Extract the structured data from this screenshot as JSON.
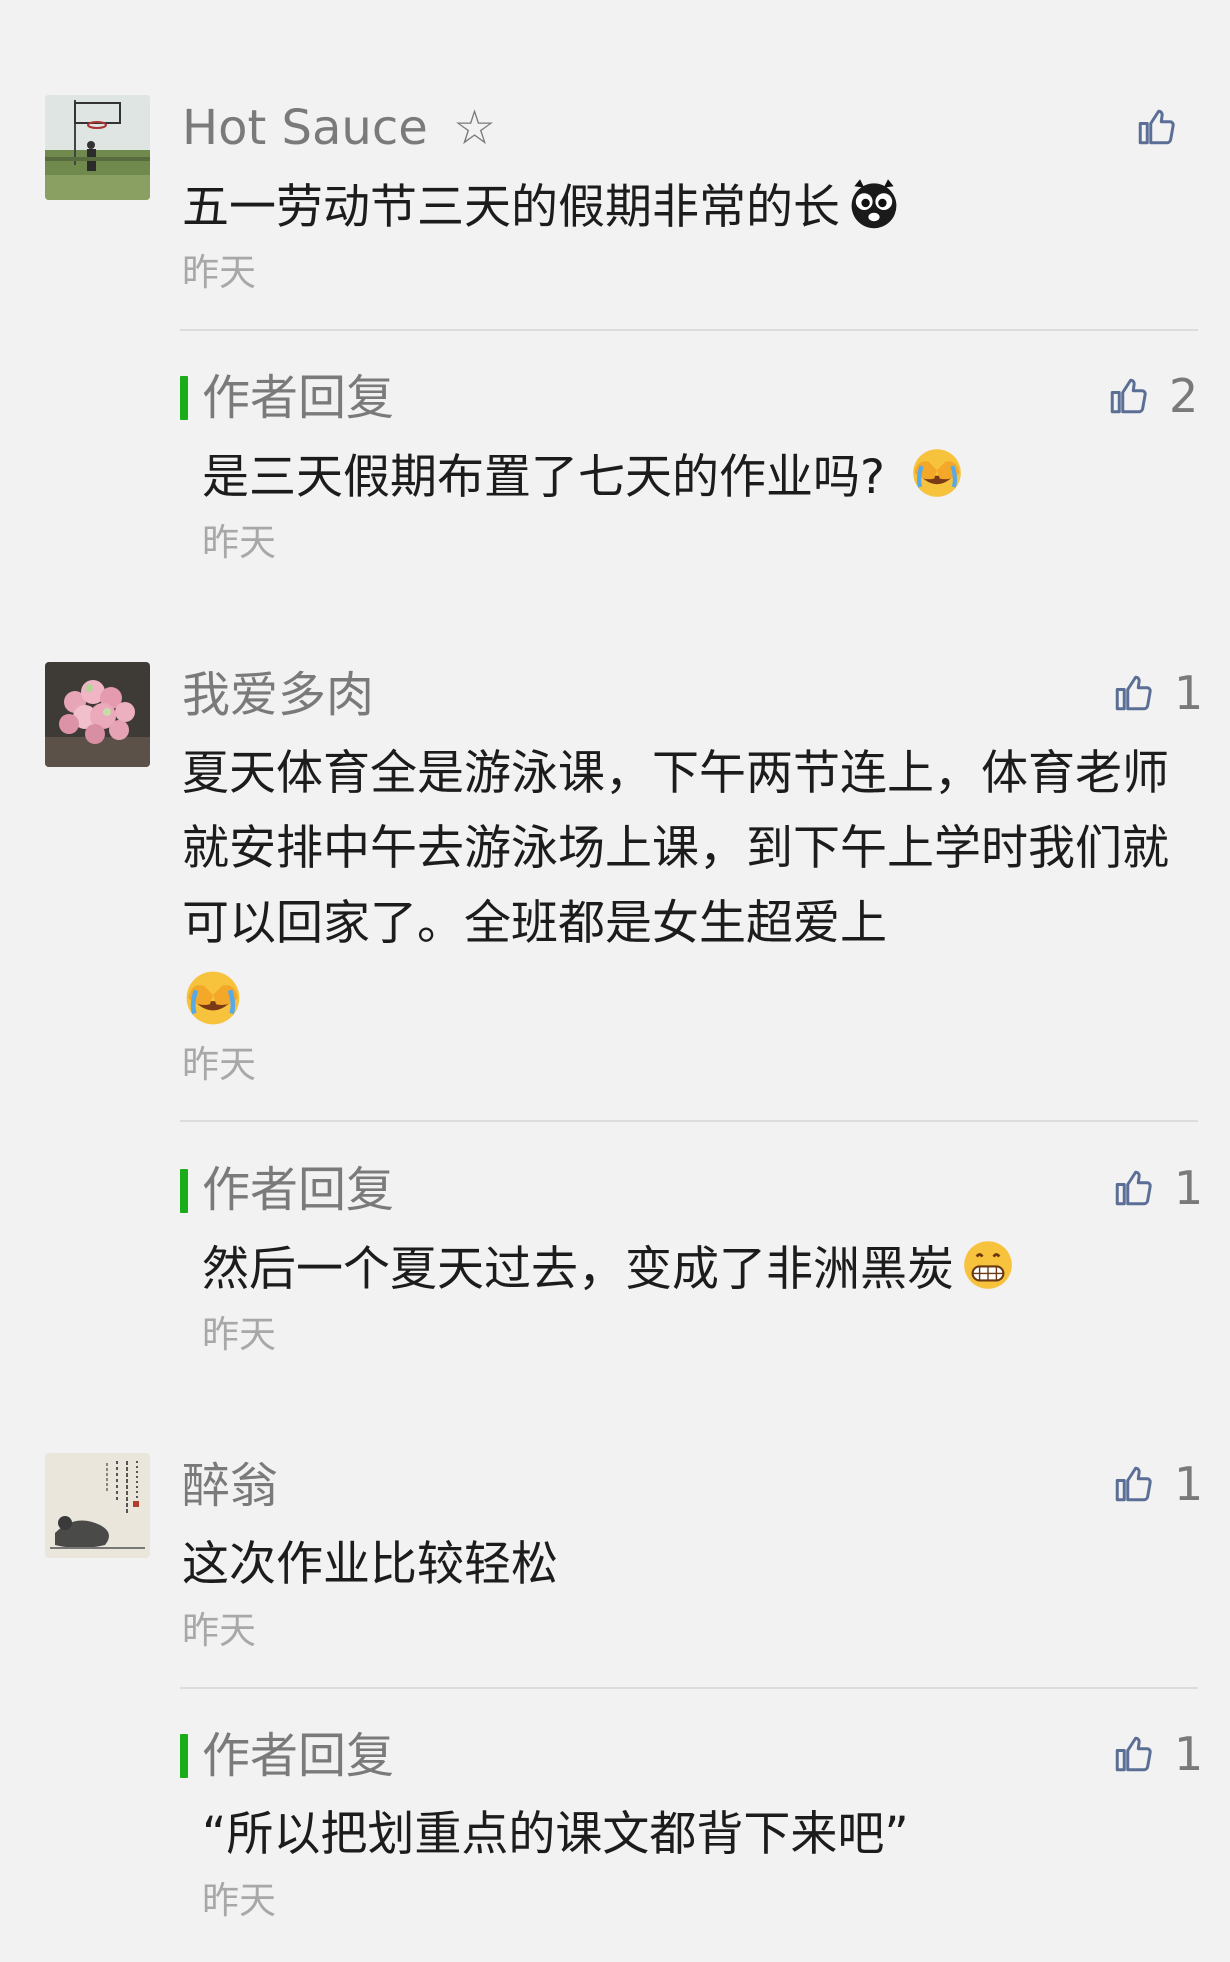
{
  "reply_label": "作者回复",
  "comments": [
    {
      "name": "Hot Sauce",
      "star": "☆",
      "text": "五一劳动节三天的假期非常的长",
      "time": "昨天",
      "likes": "",
      "avatar": "basketball-photo",
      "emoji": "scared-face-icon",
      "reply": {
        "text": "是三天假期布置了七天的作业吗?",
        "time": "昨天",
        "likes": "2",
        "emoji": "face-palm-icon"
      }
    },
    {
      "name": "我爱多肉",
      "text": "夏天体育全是游泳课，下午两节连上，体育老师就安排中午去游泳场上课，到下午上学时我们就可以回家了。全班都是女生超爱上",
      "time": "昨天",
      "likes": "1",
      "avatar": "succulent-photo",
      "emoji": "face-palm-icon",
      "reply": {
        "text": "然后一个夏天过去，变成了非洲黑炭",
        "time": "昨天",
        "likes": "1",
        "emoji": "grimace-face-icon"
      }
    },
    {
      "name": "醉翁",
      "text": "这次作业比较轻松",
      "time": "昨天",
      "likes": "1",
      "avatar": "ink-painting-photo",
      "reply": {
        "text": "“所以把划重点的课文都背下来吧”",
        "time": "昨天",
        "likes": "1"
      }
    }
  ],
  "colors": {
    "background": "#f2f2f2",
    "reply_bar": "#1aad19",
    "like_icon": "#5b6e95",
    "name_gray": "#7a7a7a",
    "time_gray": "#a8a8a8"
  }
}
